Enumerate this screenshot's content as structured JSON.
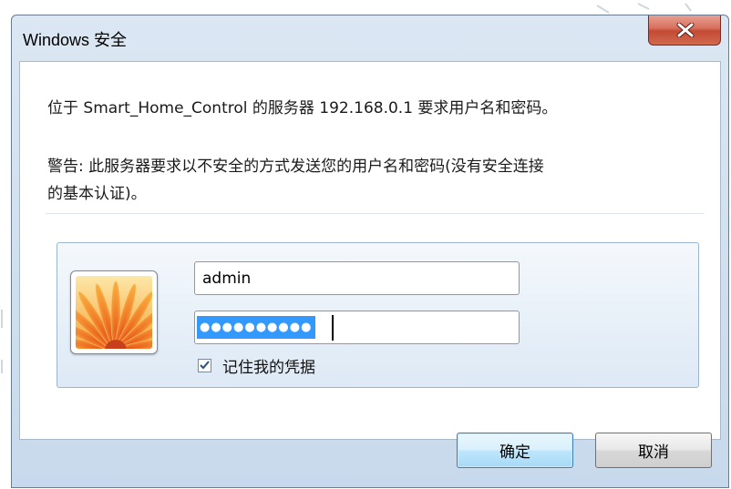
{
  "window": {
    "title": "Windows 安全",
    "close_icon": "close-x-icon"
  },
  "message": {
    "server_line": "位于 Smart_Home_Control 的服务器 192.168.0.1 要求用户名和密码。",
    "warning_line1": "警告: 此服务器要求以不安全的方式发送您的用户名和密码(没有安全连接",
    "warning_line2": "的基本认证)。"
  },
  "credentials": {
    "avatar_icon": "user-avatar-flower-icon",
    "username_value": "admin",
    "password_mask": "●●●●●●●●●●",
    "remember_label": "记住我的凭据",
    "remember_checked": true
  },
  "buttons": {
    "ok_label": "确定",
    "cancel_label": "取消"
  },
  "colors": {
    "titlebar": "#c7d9ec",
    "close_button": "#c24a34",
    "selection": "#3399ff"
  }
}
